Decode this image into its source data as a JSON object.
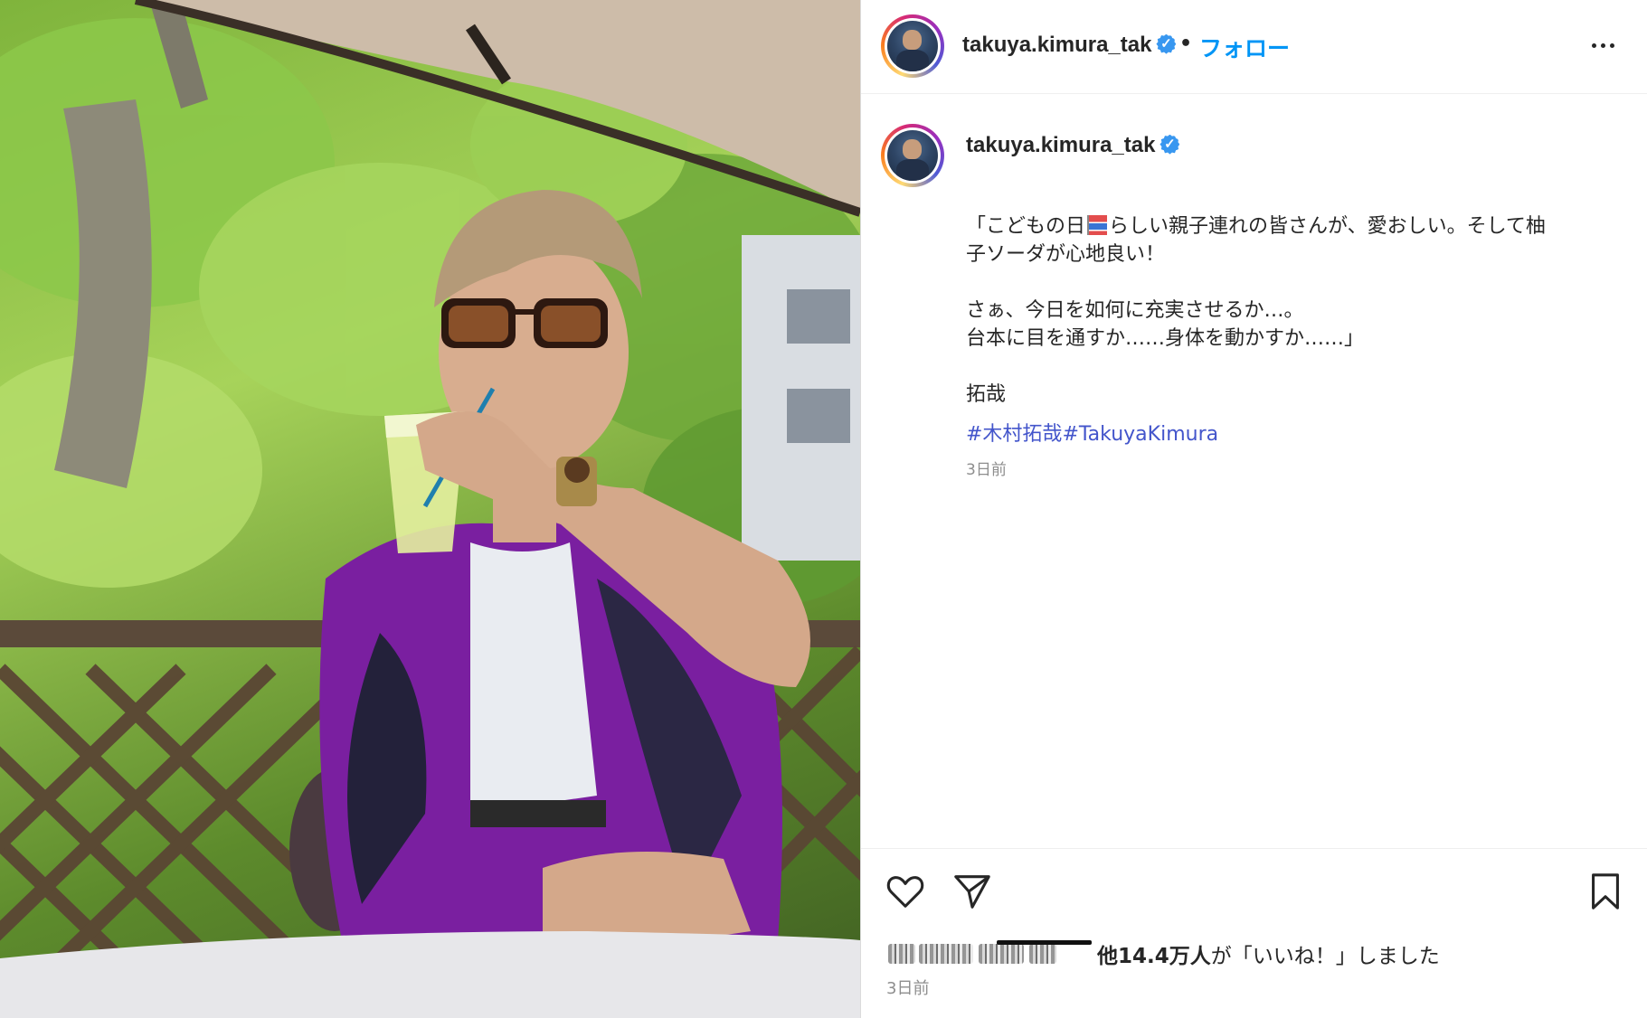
{
  "post": {
    "username": "takuya.kimura_tak",
    "verified_mark": "✓",
    "dot_separator": "•",
    "follow_label": "フォロー",
    "more_icon": "more-options-icon"
  },
  "caption": {
    "username": "takuya.kimura_tak",
    "line1_before_emoji": "「こどもの日",
    "emoji": "carp-streamer-emoji",
    "line1_after_emoji": "らしい親子連れの皆さんが、愛おしい。そして柚",
    "line2": "子ソーダが心地良い！",
    "line3": "さぁ、今日を如何に充実させるか…。",
    "line4": "台本に目を通すか……身体を動かすか……」",
    "signature": "拓哉",
    "hashtag1": "#木村拓哉",
    "hashtag2": "#TakuyaKimura",
    "time": "3日前"
  },
  "actions": {
    "like_icon": "heart-icon",
    "share_icon": "paper-plane-icon",
    "save_icon": "bookmark-icon"
  },
  "likes": {
    "count": "他14.4万人",
    "suffix": "が「いいね！」しました"
  },
  "post_time": "3日前",
  "colors": {
    "follow": "#0095f6",
    "hashtag": "#4355cb",
    "verified": "#3897f0",
    "muted": "#8e8e8e"
  }
}
